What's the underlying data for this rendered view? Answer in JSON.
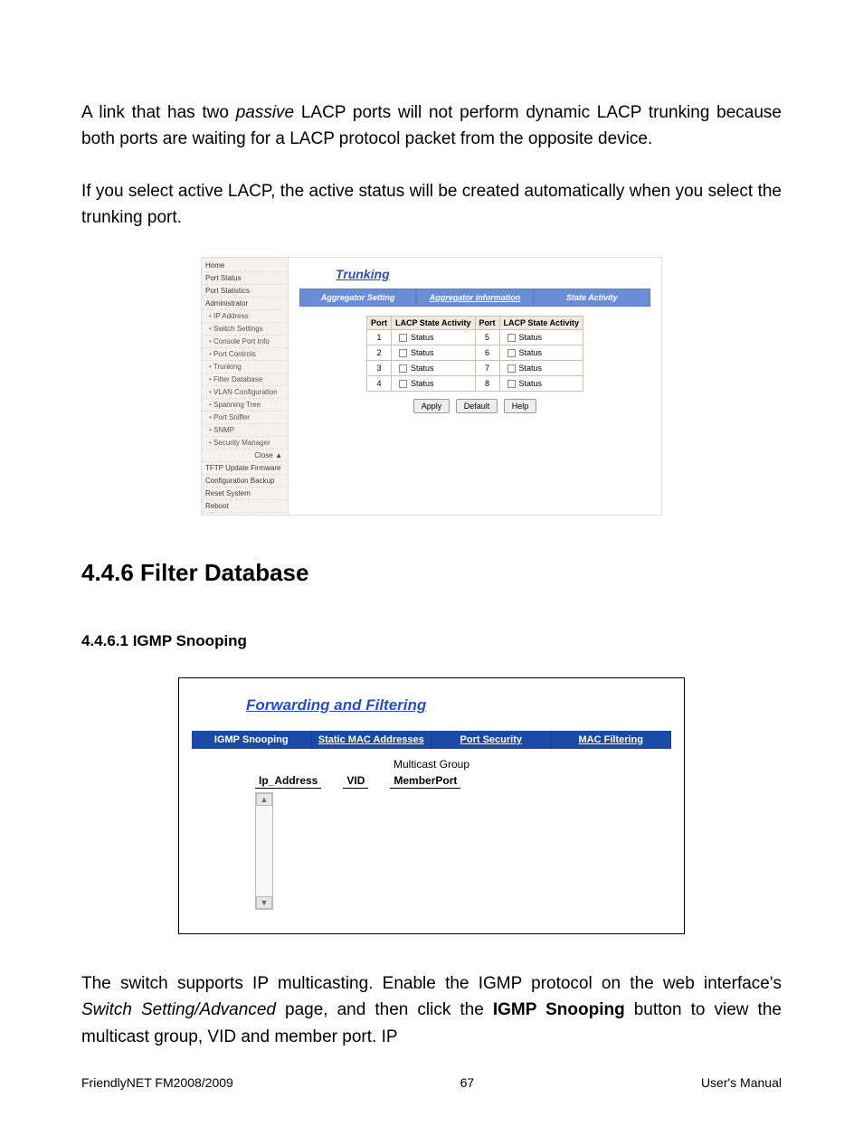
{
  "para1_a": "A link that has two ",
  "para1_b": "passive",
  "para1_c": " LACP ports will not perform dynamic LACP trunking because both ports are waiting for a LACP protocol packet from the opposite device.",
  "para2": "If you select active LACP, the active status will be created automatically when you select the trunking port.",
  "shot1": {
    "sidebar": {
      "home": "Home",
      "port_status": "Port Status",
      "port_statistics": "Port Statistics",
      "administrator": "Administrator",
      "sub": [
        "IP Address",
        "Switch Settings",
        "Console Port Info",
        "Port Controls",
        "Trunking",
        "Filter Database",
        "VLAN Configuration",
        "Spanning Tree",
        "Port Sniffer",
        "SNMP",
        "Security Manager"
      ],
      "close": "Close ▲",
      "tftp": "TFTP Update Firmware",
      "config_backup": "Configuration Backup",
      "reset": "Reset System",
      "reboot": "Reboot"
    },
    "title": "Trunking",
    "tabs": [
      "Aggregator Setting",
      "Aggregator information",
      "State Activity"
    ],
    "th": [
      "Port",
      "LACP State Activity",
      "Port",
      "LACP State Activity"
    ],
    "rows": [
      {
        "p1": "1",
        "s1": "Status",
        "p2": "5",
        "s2": "Status"
      },
      {
        "p1": "2",
        "s1": "Status",
        "p2": "6",
        "s2": "Status"
      },
      {
        "p1": "3",
        "s1": "Status",
        "p2": "7",
        "s2": "Status"
      },
      {
        "p1": "4",
        "s1": "Status",
        "p2": "8",
        "s2": "Status"
      }
    ],
    "buttons": [
      "Apply",
      "Default",
      "Help"
    ]
  },
  "h2": "4.4.6 Filter Database",
  "h3": "4.4.6.1 IGMP Snooping",
  "shot2": {
    "title": "Forwarding and Filtering",
    "tabs": [
      "IGMP Snooping",
      "Static MAC Addresses",
      "Port Security",
      "MAC Filtering"
    ],
    "group_label": "Multicast Group",
    "cols": [
      "Ip_Address",
      "VID",
      "MemberPort"
    ]
  },
  "para3_a": "The switch supports IP multicasting. Enable the IGMP protocol on the web interface's ",
  "para3_b": "Switch Setting/Advanced",
  "para3_c": " page, and then click the ",
  "para3_d": "IGMP Snooping",
  "para3_e": " button to view the multicast group, VID and member port. IP",
  "footer": {
    "left": "FriendlyNET FM2008/2009",
    "center": "67",
    "right": "User's Manual"
  }
}
